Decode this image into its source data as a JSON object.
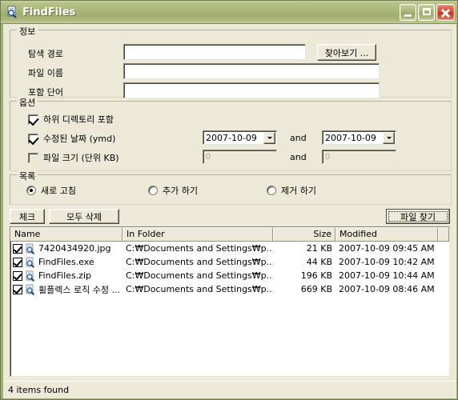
{
  "window": {
    "title": "FindFiles",
    "app_icon": "magnifier-document-icon",
    "minimize_label": "Minimize",
    "maximize_label": "Maximize",
    "close_label": "Close"
  },
  "info_group": {
    "title": "정보",
    "fields": [
      {
        "label": "탐색 경로",
        "value": "",
        "placeholder": ""
      },
      {
        "label": "파일 이름",
        "value": "",
        "placeholder": ""
      },
      {
        "label": "포함 단어",
        "value": "",
        "placeholder": ""
      }
    ],
    "browse_button": "찾아보기 ..."
  },
  "options_group": {
    "title": "옵션",
    "include_subdirs": {
      "label": "하위 디렉토리 포함",
      "checked": true
    },
    "modified_date": {
      "label": "수정된 날짜 (ymd)",
      "checked": true,
      "from": "2007-10-09",
      "to": "2007-10-09",
      "separator": "and"
    },
    "file_size": {
      "label": "파일 크기 (단위 KB)",
      "checked": false,
      "from": "0",
      "to": "0",
      "separator": "and"
    }
  },
  "list_group": {
    "title": "목록",
    "options": [
      {
        "label": "새로 고침",
        "selected": true
      },
      {
        "label": "추가 하기",
        "selected": false
      },
      {
        "label": "제거 하기",
        "selected": false
      }
    ]
  },
  "toolbar": {
    "check_button": "체크",
    "delete_all_button": "모두 삭제",
    "find_button": "파일 찾기"
  },
  "filelist": {
    "columns": [
      "Name",
      "In Folder",
      "Size",
      "Modified"
    ],
    "rows": [
      {
        "checked": true,
        "icon": "file-search-icon",
        "name": "7420434920.jpg",
        "folder": "C:₩Documents and Settings₩p...",
        "size": "21 KB",
        "modified": "2007-10-09 09:45 AM"
      },
      {
        "checked": true,
        "icon": "file-search-icon",
        "name": "FindFiles.exe",
        "folder": "C:₩Documents and Settings₩p...",
        "size": "44 KB",
        "modified": "2007-10-09 10:42 AM"
      },
      {
        "checked": true,
        "icon": "file-search-icon",
        "name": "FindFiles.zip",
        "folder": "C:₩Documents and Settings₩p...",
        "size": "196 KB",
        "modified": "2007-10-09 10:44 AM"
      },
      {
        "checked": true,
        "icon": "file-search-icon",
        "name": "휠플렉스 로직 수정 ...",
        "folder": "C:₩Documents and Settings₩p...",
        "size": "669 KB",
        "modified": "2007-10-09 08:46 AM"
      }
    ]
  },
  "statusbar": {
    "text": "4 items found"
  },
  "colors": {
    "window_frame": "#9db06f",
    "titlebar": "#a7b476",
    "face": "#ece9d8",
    "close_button": "#c03a20",
    "field_bg": "#ffffff"
  }
}
